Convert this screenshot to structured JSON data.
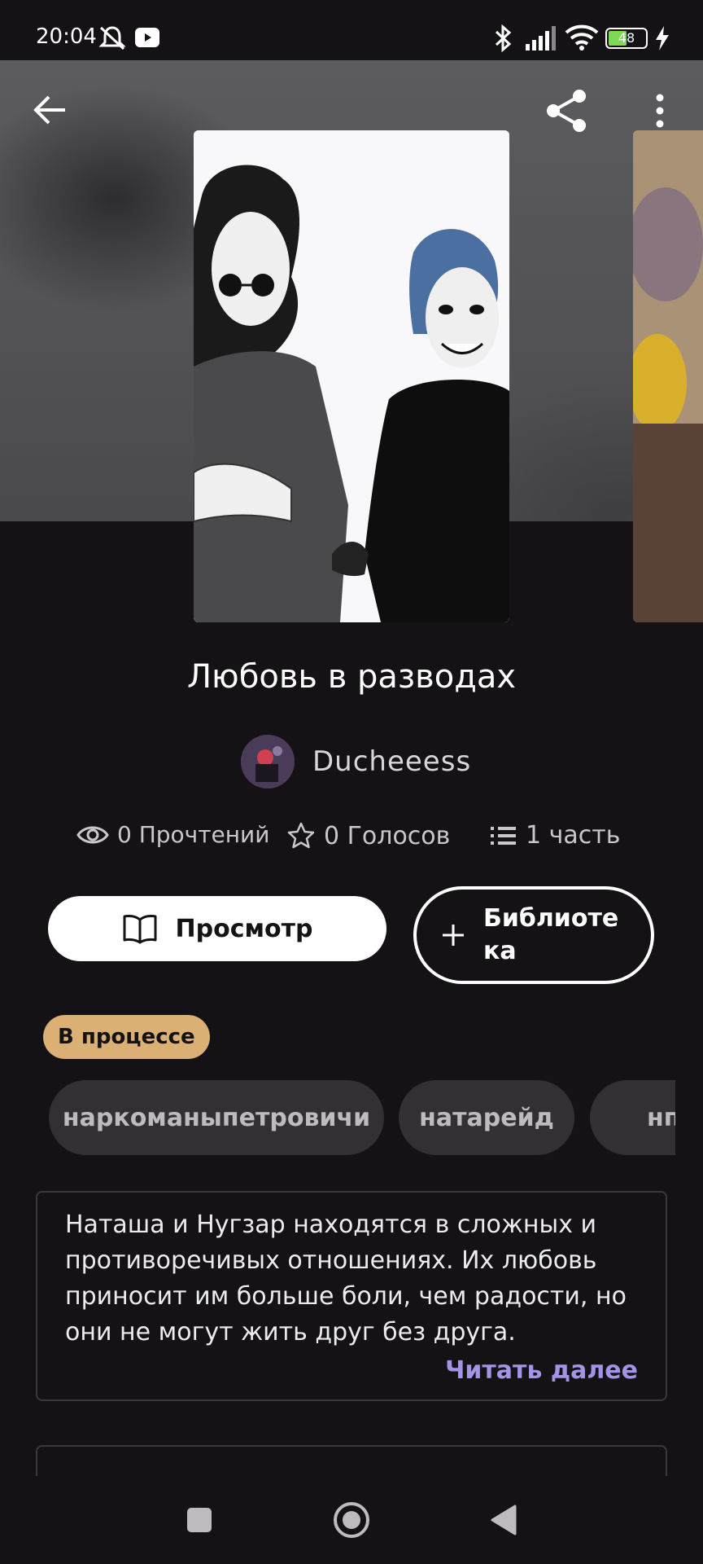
{
  "status_bar": {
    "time": "20:04",
    "battery_level": "48",
    "icons": [
      "mute-icon",
      "youtube-icon",
      "bluetooth-icon",
      "signal-icon",
      "wifi-icon",
      "battery-icon",
      "charging-icon"
    ]
  },
  "toolbar": {
    "back_icon": "arrow-left-icon",
    "share_icon": "share-icon",
    "menu_icon": "more-vert-icon"
  },
  "story": {
    "title": "Любовь в разводах",
    "author": "Ducheeess",
    "stats": {
      "reads": "0 Прочтений",
      "votes": "0 Голосов",
      "parts": "1 часть"
    },
    "actions": {
      "view_label": "Просмотр",
      "library_label": "Библиотека"
    },
    "status": "В процессе",
    "tags": [
      "наркоманыпетровичи",
      "натарейд",
      "нп"
    ],
    "description": "Наташа и Нугзар находятся в сложных и противоречивых отношениях. Их любовь приносит им больше боли, чем радости, но они не могут жить друг без друга.",
    "read_more": "Читать далее"
  },
  "colors": {
    "background": "#141214",
    "badge": "#dab075",
    "tag_bg": "#323034",
    "link": "#a394e6"
  }
}
